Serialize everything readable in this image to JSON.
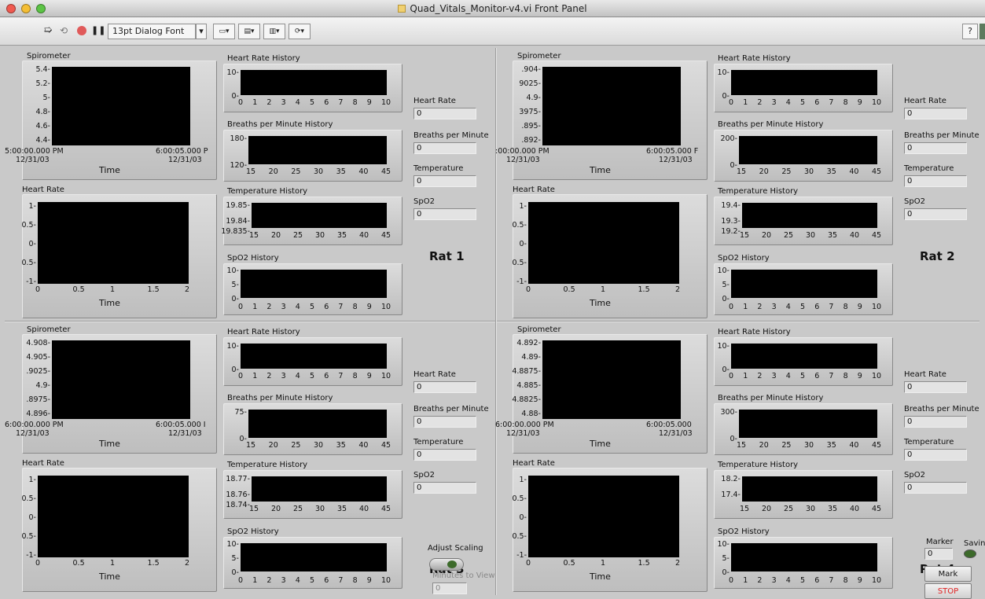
{
  "window": {
    "title": "Quad_Vitals_Monitor-v4.vi Front Panel"
  },
  "toolbar": {
    "font": "13pt Dialog Font",
    "help": "?"
  },
  "common": {
    "spiro_title": "Spirometer",
    "hr_graph_title": "Heart Rate",
    "hr_hist": "Heart Rate History",
    "bpm_hist": "Breaths per Minute History",
    "temp_hist": "Temperature History",
    "spo2_hist": "SpO2 History",
    "time_label": "Time",
    "ind_hr": "Heart Rate",
    "ind_bpm": "Breaths per Minute",
    "ind_temp": "Temperature",
    "ind_spo2": "SpO2",
    "hr_graph_y": [
      "1-",
      "0.5-",
      "0-",
      "0.5-",
      "-1-"
    ],
    "hr_graph_x": [
      "0",
      "0.5",
      "1",
      "1.5",
      "2"
    ],
    "x_0_10": [
      "0",
      "1",
      "2",
      "3",
      "4",
      "5",
      "6",
      "7",
      "8",
      "9",
      "10"
    ],
    "x_15_45": [
      "15",
      "20",
      "25",
      "30",
      "35",
      "40",
      "45"
    ],
    "y_10_0": [
      "10-",
      "0-"
    ],
    "y_spo2": [
      "10-",
      "5-",
      "0-"
    ]
  },
  "rats": [
    {
      "name": "Rat 1",
      "values": {
        "hr": "0",
        "bpm": "0",
        "temp": "0",
        "spo2": "0"
      },
      "spiro_y": [
        "5.4-",
        "5.2-",
        "5-",
        "4.8-",
        "4.6-",
        "4.4-"
      ],
      "spiro_x_left": "5:00:00.000 PM",
      "spiro_x_right": "6:00:05.000 P",
      "spiro_date_left": "12/31/03",
      "spiro_date_right": "12/31/03",
      "bpm_y": [
        "180-",
        "120-"
      ],
      "temp_y": [
        "19.85-",
        "19.84-",
        "19.835-"
      ]
    },
    {
      "name": "Rat 2",
      "values": {
        "hr": "0",
        "bpm": "0",
        "temp": "0",
        "spo2": "0"
      },
      "spiro_y": [
        ".904-",
        "9025-",
        "4.9-",
        "3975-",
        ".895-",
        ".892-"
      ],
      "spiro_x_left": ":00:00.000 PM",
      "spiro_x_right": "6:00:05.000 F",
      "spiro_date_left": "12/31/03",
      "spiro_date_right": "12/31/03",
      "bpm_y": [
        "200-",
        "0-"
      ],
      "temp_y": [
        "19.4-",
        "19.3-",
        "19.2-"
      ]
    },
    {
      "name": "Rat 3",
      "values": {
        "hr": "0",
        "bpm": "0",
        "temp": "0",
        "spo2": "0"
      },
      "spiro_y": [
        "4.908-",
        "4.905-",
        ".9025-",
        "4.9-",
        ".8975-",
        "4.896-"
      ],
      "spiro_x_left": "6:00:00.000 PM",
      "spiro_x_right": "6:00:05.000 I",
      "spiro_date_left": "12/31/03",
      "spiro_date_right": "12/31/03",
      "bpm_y": [
        "75-",
        "0-"
      ],
      "temp_y": [
        "18.77-",
        "18.76-",
        "18.74-"
      ]
    },
    {
      "name": "Rat 4",
      "values": {
        "hr": "0",
        "bpm": "0",
        "temp": "0",
        "spo2": "0"
      },
      "spiro_y": [
        "4.892-",
        "4.89-",
        "4.8875-",
        "4.885-",
        "4.8825-",
        "4.88-"
      ],
      "spiro_x_left": "6:00:00.000 PM",
      "spiro_x_right": "6:00:05.000",
      "spiro_date_left": "12/31/03",
      "spiro_date_right": "12/31/03",
      "bpm_y": [
        "300-",
        "0-"
      ],
      "temp_y": [
        "18.2-",
        "17.4-"
      ]
    }
  ],
  "controls": {
    "adjust_scaling": "Adjust Scaling",
    "minutes_to_view": "Minutes to View",
    "minutes_value": "0",
    "marker_label": "Marker",
    "marker_value": "0",
    "saving_label": "Saving",
    "mark": "Mark",
    "stop": "STOP"
  },
  "colors": {
    "plot_bg": "#000000",
    "panel": "#c9c9c9",
    "stop_text": "#e02020",
    "led": "#3c6a2a"
  }
}
